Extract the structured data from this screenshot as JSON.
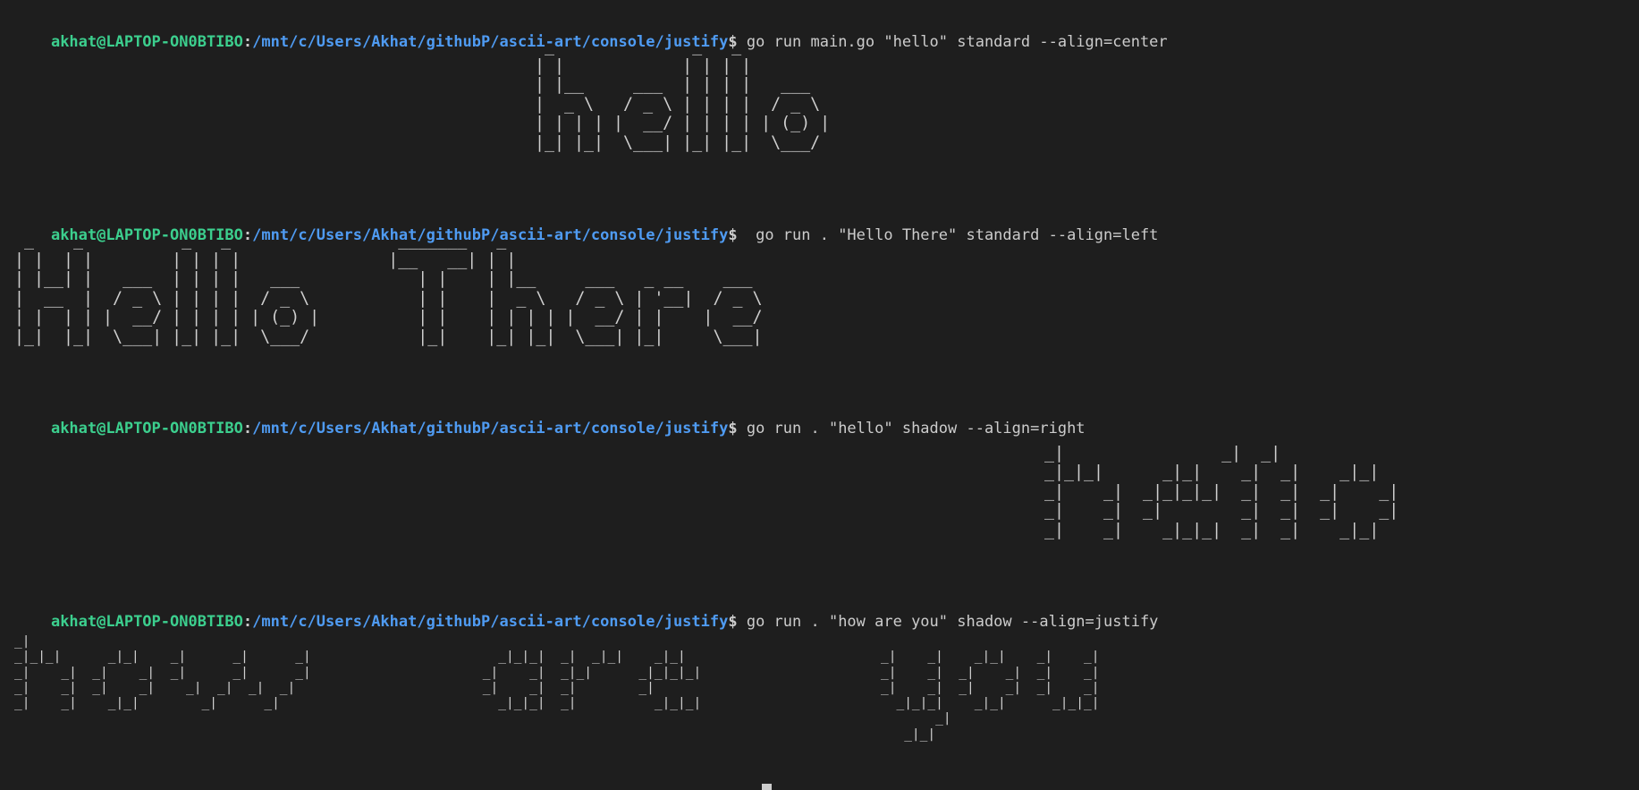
{
  "prompt": {
    "user_host": "akhat@LAPTOP-ON0BTIBO",
    "colon": ":",
    "path": "/mnt/c/Users/Akhat/githubP/ascii-art/console/justify",
    "dollar": "$"
  },
  "blocks": [
    {
      "command": " go run main.go \"hello\" standard --align=center",
      "art": " _              _   _          \n| |            | | | |         \n| |__     ___  | | | |   ___   \n|  _ \\   / _ \\ | | | |  / _ \\  \n| | | | |  __/ | | | | | (_) | \n|_| |_|  \\___| |_| |_|  \\___/  "
    },
    {
      "command": "  go run . \"Hello There\" standard --align=left",
      "art": " _    _          _   _                 _______   _                               \n| |  | |        | | | |               |__   __| | |                              \n| |__| |   ___  | | | |   ___            | |    | |__     ___   _ __    ___      \n|  __  |  / _ \\ | | | |  / _ \\           | |    |  _ \\   / _ \\ | '__|  / _ \\     \n| |  | | |  __/ | | | | | (_) |          | |    | | | | |  __/ | |    |  __/     \n|_|  |_|  \\___| |_| |_|  \\___/           |_|    |_| |_|  \\___| |_|     \\___|     "
    },
    {
      "command": " go run . \"hello\" shadow --align=right",
      "art": "                                 \n_|                _|  _|        \n_|_|_|      _|_|    _|  _|    _|_|    \n_|    _|  _|_|_|_|  _|  _|  _|    _|  \n_|    _|  _|        _|  _|  _|    _|  \n_|    _|    _|_|_|  _|  _|    _|_|    "
    },
    {
      "command": " go run . \"how are you\" shadow --align=justify",
      "art": "_|                                                                                                                                            \n_|_|_|      _|_|    _|      _|      _|                        _|_|_|  _|  _|_|    _|_|                         _|    _|    _|_|    _|    _|  \n_|    _|  _|    _|  _|      _|      _|                      _|    _|  _|_|      _|_|_|_|                       _|    _|  _|    _|  _|    _|  \n_|    _|  _|    _|    _|  _|  _|  _|                        _|    _|  _|        _|                             _|    _|  _|    _|  _|    _|  \n_|    _|    _|_|        _|      _|                            _|_|_|  _|          _|_|_|                         _|_|_|    _|_|      _|_|_|  \n                                                                                                                      _|                    \n                                                                                                                  _|_|                      "
    }
  ]
}
